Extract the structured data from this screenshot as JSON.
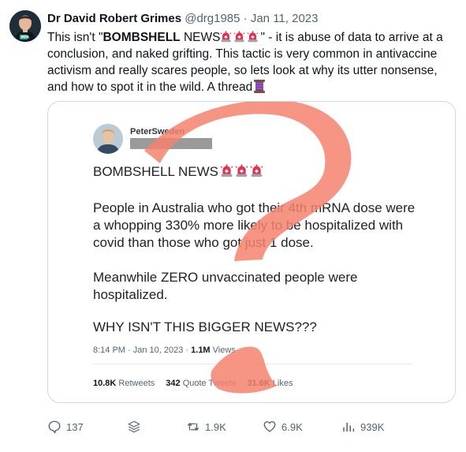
{
  "tweet": {
    "author_name": "Dr David Robert Grimes",
    "handle": "@drg1985",
    "separator": " · ",
    "date": "Jan 11, 2023",
    "body": {
      "part1": "This isn't \"",
      "bold": "BOMBSHELL",
      "part2": " NEWS",
      "part3": "\" - it is abuse of data to arrive at a conclusion, and naked grifting. This tactic is very common in antivaccine activism and really scares people, so lets look at why its utter nonsense, and how to spot it in the wild. A thread"
    },
    "icons": {
      "siren": "police-light-emoji",
      "thread": "spool-of-thread-emoji"
    }
  },
  "quoted": {
    "name": "PeterSweden",
    "lines": {
      "l1": "BOMBSHELL NEWS",
      "l2a": "People in Australia who got their 4th mRNA dose were",
      "l2b": "a whopping 330% more likely to be hospitalized with",
      "l2c": "covid than those who got just 1 dose.",
      "l3a": "Meanwhile ZERO unvaccinated people were",
      "l3b": "hospitalized.",
      "l4": "WHY ISN'T THIS BIGGER NEWS???"
    },
    "meta": {
      "time": "8:14 PM · Jan 10, 2023 · ",
      "views_count": "1.1M",
      "views_label": " Views"
    },
    "stats": {
      "retweets_count": "10.8K",
      "retweets_label": " Retweets",
      "quotes_count": "342",
      "quotes_label": " Quote Tweets",
      "likes_count": "31.6K",
      "likes_label": " Likes"
    },
    "overlay_color": "#f4826f"
  },
  "actions": {
    "replies": "137",
    "retweets": "1.9K",
    "likes": "6.9K",
    "views": "939K"
  },
  "colors": {
    "text": "#0f1419",
    "secondary": "#536471",
    "border": "#cfd9de",
    "siren_red": "#e0334d",
    "thread_purple": "#7b3fa0"
  }
}
